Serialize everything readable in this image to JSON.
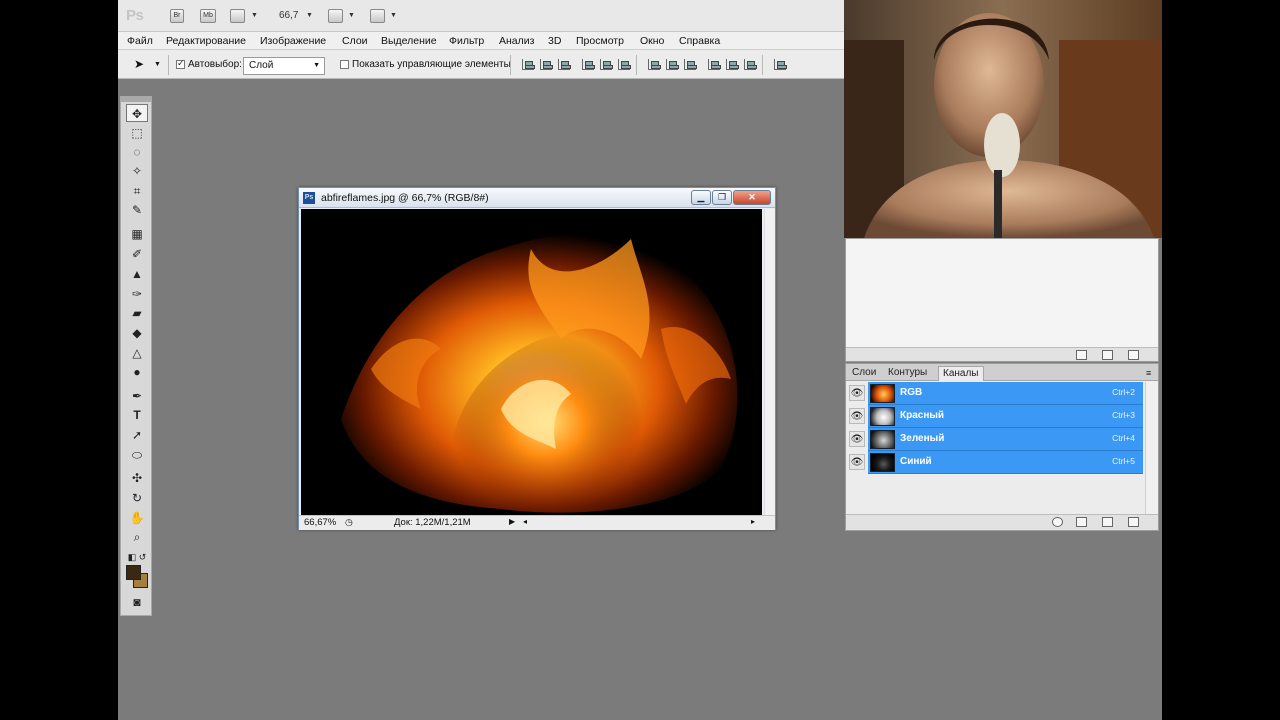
{
  "appbar": {
    "logo": "Ps",
    "bridge_label": "Br",
    "minibridge_label": "Mb",
    "zoom_value": "66,7",
    "dropdown_arrow": "▼"
  },
  "menu": [
    "Файл",
    "Редактирование",
    "Изображение",
    "Слои",
    "Выделение",
    "Фильтр",
    "Анализ",
    "3D",
    "Просмотр",
    "Окно",
    "Справка"
  ],
  "options": {
    "autoselect_label": "Автовыбор:",
    "autoselect_value": "Слой",
    "show_controls_label": "Показать управляющие элементы"
  },
  "document": {
    "title": "abfireflames.jpg @ 66,7% (RGB/8#)",
    "zoom": "66,67%",
    "doc_info": "Док: 1,22M/1,21M",
    "ps_icon": "Ps",
    "minimize": "▁",
    "restore": "❐",
    "close": "✕"
  },
  "panel": {
    "tabs": [
      "Слои",
      "Контуры",
      "Каналы"
    ],
    "active_tab": "Каналы",
    "channels": [
      {
        "name": "RGB",
        "shortcut": "Ctrl+2"
      },
      {
        "name": "Красный",
        "shortcut": "Ctrl+3"
      },
      {
        "name": "Зеленый",
        "shortcut": "Ctrl+4"
      },
      {
        "name": "Синий",
        "shortcut": "Ctrl+5"
      }
    ]
  },
  "colors": {
    "selection": "#3b99f5",
    "foreground": "#3a2810",
    "background": "#a57f3e",
    "workspace": "#7b7b7b"
  }
}
